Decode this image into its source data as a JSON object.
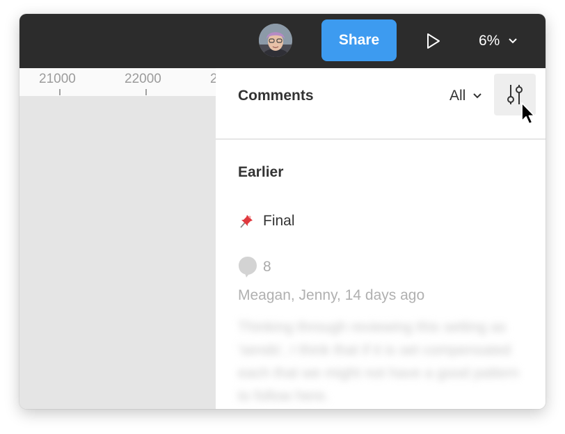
{
  "toolbar": {
    "avatar_icon": "user-avatar",
    "share_label": "Share",
    "play_icon": "play-triangle-icon",
    "zoom_label": "6%",
    "zoom_icon": "chevron-down-icon"
  },
  "ruler": {
    "ticks": [
      "21000",
      "22000",
      "2"
    ]
  },
  "comments": {
    "title": "Comments",
    "filter_value": "All",
    "filter_icon": "chevron-down-icon",
    "settings_icon": "sliders-icon",
    "section_heading": "Earlier",
    "thread": {
      "pin_icon": "pushpin-icon",
      "title": "Final",
      "reply_icon": "comment-bubble-icon",
      "reply_count": "8",
      "meta": "Meagan, Jenny, 14 days ago",
      "preview": "Thinking through reviewing this setting as 'sends', I think that if it is set compensated each that we might not have a good pattern to follow here."
    }
  },
  "colors": {
    "toolbar_bg": "#2c2c2c",
    "share_button": "#3d9bf0",
    "canvas_bg": "#e5e5e5",
    "panel_bg": "#ffffff"
  }
}
